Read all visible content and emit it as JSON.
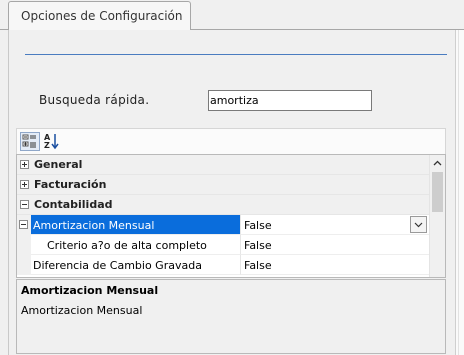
{
  "tab": {
    "label": "Opciones de Configuración"
  },
  "search": {
    "label": "Busqueda rápida.",
    "value": "amortiza"
  },
  "toolbar": {
    "categorized_icon": "categorized-icon",
    "alphabetical_icon": "sort-alphabetical-icon"
  },
  "grid": {
    "categories": [
      {
        "label": "General",
        "expanded": false
      },
      {
        "label": "Facturación",
        "expanded": false
      },
      {
        "label": "Contabilidad",
        "expanded": true
      }
    ],
    "properties": [
      {
        "name": "Amortizacion Mensual",
        "value": "False",
        "selected": true
      },
      {
        "name": "Criterio a?o de alta completo",
        "value": "False",
        "selected": false
      },
      {
        "name": "Diferencia de Cambio Gravada",
        "value": "False",
        "selected": false
      }
    ]
  },
  "description": {
    "title": "Amortizacion Mensual",
    "text": "Amortizacion Mensual"
  },
  "colors": {
    "selection": "#0a6ddc",
    "accent_rule": "#4a7cc0"
  }
}
